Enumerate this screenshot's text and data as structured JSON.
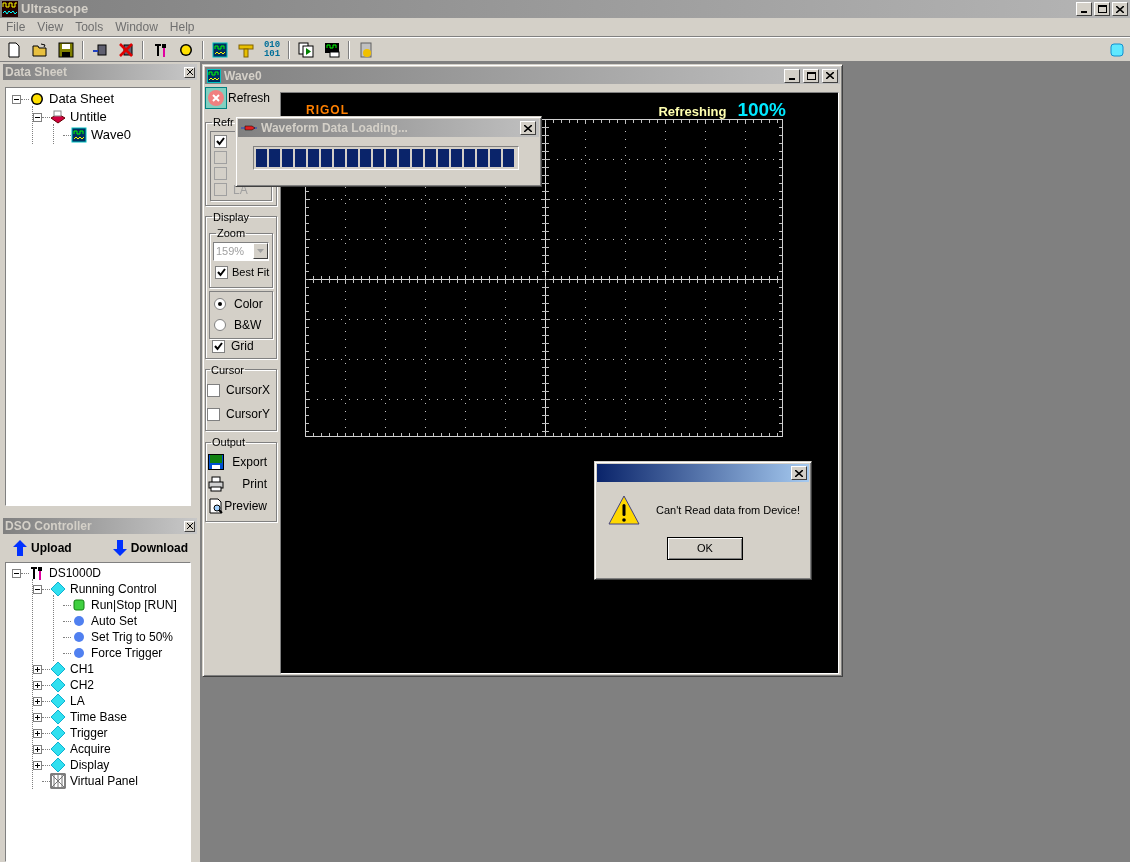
{
  "app": {
    "title": "Ultrascope",
    "menu": [
      "File",
      "View",
      "Tools",
      "Window",
      "Help"
    ]
  },
  "toolbar": {
    "binary_label": [
      "010",
      "101"
    ]
  },
  "data_sheet": {
    "title": "Data Sheet",
    "tree": [
      {
        "label": "Data Sheet",
        "kind": "sheet",
        "expanded": true,
        "children": [
          {
            "label": "Untitle",
            "kind": "file",
            "expanded": true,
            "children": [
              {
                "label": "Wave0",
                "kind": "wave"
              }
            ]
          }
        ]
      }
    ]
  },
  "dso_controller": {
    "title": "DSO Controller",
    "buttons": [
      {
        "label": "Upload",
        "kind": "up"
      },
      {
        "label": "Download",
        "kind": "down"
      }
    ],
    "tree": [
      {
        "label": "DS1000D",
        "kind": "device",
        "expanded": true,
        "children": [
          {
            "label": "Running Control",
            "kind": "group",
            "expanded": true,
            "children": [
              {
                "label": "Run|Stop [RUN]",
                "kind": "run"
              },
              {
                "label": "Auto Set",
                "kind": "command"
              },
              {
                "label": "Set Trig to 50%",
                "kind": "command"
              },
              {
                "label": "Force Trigger",
                "kind": "command"
              }
            ]
          },
          {
            "label": "CH1",
            "kind": "group",
            "expanded": false
          },
          {
            "label": "CH2",
            "kind": "group",
            "expanded": false
          },
          {
            "label": "LA",
            "kind": "group",
            "expanded": false
          },
          {
            "label": "Time Base",
            "kind": "group",
            "expanded": false
          },
          {
            "label": "Trigger",
            "kind": "group",
            "expanded": false
          },
          {
            "label": "Acquire",
            "kind": "group",
            "expanded": false
          },
          {
            "label": "Display",
            "kind": "group",
            "expanded": false
          },
          {
            "label": "Virtual Panel",
            "kind": "panel"
          }
        ]
      }
    ]
  },
  "wave_window": {
    "title": "Wave0",
    "refresh_button": "Refresh",
    "refresh_group": {
      "title": "Refr",
      "options": [
        {
          "checked": true,
          "disabled": false
        },
        {
          "checked": false,
          "disabled": true
        },
        {
          "checked": false,
          "disabled": true
        },
        {
          "label": "LA",
          "checked": false,
          "disabled": true
        }
      ]
    },
    "display_group": {
      "title": "Display",
      "zoom": {
        "title": "Zoom",
        "value": "159%",
        "disabled": true,
        "best_fit": {
          "label": "Best Fit",
          "checked": true
        }
      },
      "modes": [
        {
          "label": "Color",
          "selected": true
        },
        {
          "label": "B&W",
          "selected": false
        }
      ],
      "grid": {
        "label": "Grid",
        "checked": true
      }
    },
    "cursor_group": {
      "title": "Cursor",
      "options": [
        {
          "label": "CursorX",
          "checked": false
        },
        {
          "label": "CursorY",
          "checked": false
        }
      ]
    },
    "output_group": {
      "title": "Output",
      "buttons": [
        {
          "label": "Export",
          "kind": "export"
        },
        {
          "label": "Print",
          "kind": "print"
        },
        {
          "label": "Preview",
          "kind": "preview"
        }
      ]
    },
    "scope": {
      "brand": "RIGOL",
      "status": "Refreshing",
      "percent": "100%"
    }
  },
  "loading_dialog": {
    "title": "Waveform Data Loading...",
    "level": 1
  },
  "alert": {
    "message": "Can't Read data from Device!",
    "button": "OK"
  }
}
